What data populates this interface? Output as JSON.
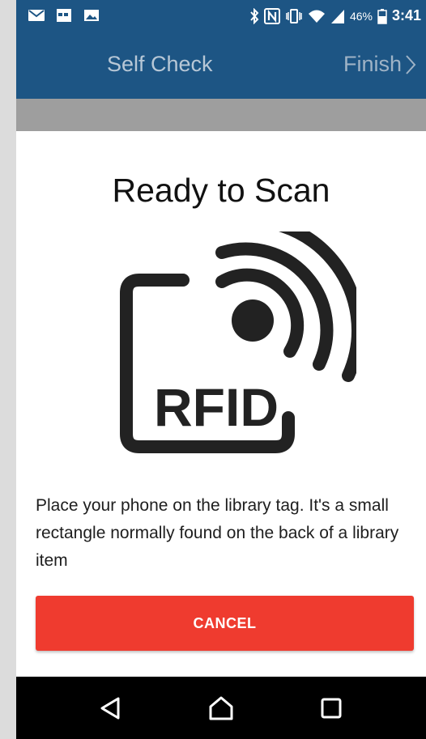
{
  "status_bar": {
    "battery_percent": "46%",
    "time": "3:41",
    "left_icons": [
      "mail-icon",
      "calendar-icon",
      "image-icon"
    ],
    "right_icons": [
      "bluetooth-icon",
      "nfc-icon",
      "vibrate-icon",
      "wifi-icon",
      "signal-icon",
      "battery-icon"
    ]
  },
  "app_bar": {
    "title": "Self Check",
    "finish_label": "Finish"
  },
  "dialog": {
    "title": "Ready to Scan",
    "rfid_label": "RFID",
    "message": "Place your phone on the library tag. It's a small rectangle normally found on the back of a library item",
    "cancel_label": "CANCEL"
  },
  "nav_bar": {
    "buttons": [
      "back-icon",
      "home-icon",
      "recents-icon"
    ]
  },
  "colors": {
    "app_bar": "#1d5584",
    "accent_button": "#ef3b2f",
    "nav_bar": "#000000"
  }
}
